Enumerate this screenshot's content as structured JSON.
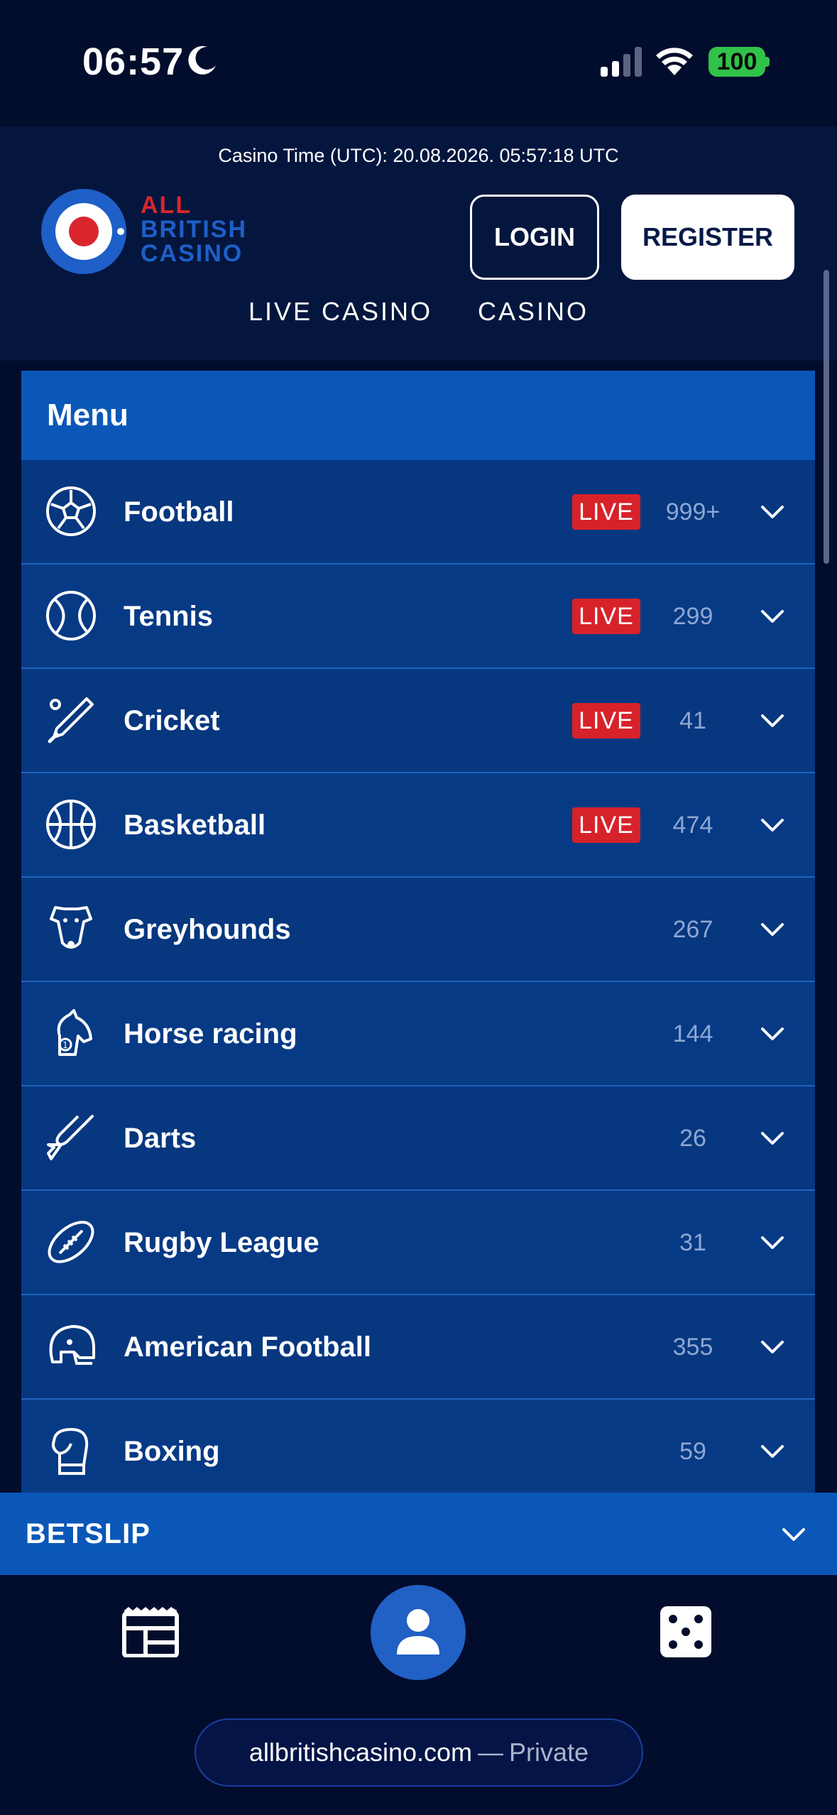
{
  "status_bar": {
    "time": "06:57",
    "battery": "100"
  },
  "header": {
    "casino_time": "Casino Time (UTC): 20.08.2026. 05:57:18 UTC",
    "logo": {
      "line1": "ALL",
      "line2": "BRITISH",
      "line3": "CASINO"
    },
    "login_label": "LOGIN",
    "register_label": "REGISTER",
    "nav": [
      "LIVE CASINO",
      "CASINO"
    ]
  },
  "menu": {
    "title": "Menu",
    "items": [
      {
        "label": "Football",
        "live": "LIVE",
        "count": "999+",
        "icon": "football-icon"
      },
      {
        "label": "Tennis",
        "live": "LIVE",
        "count": "299",
        "icon": "tennis-ball-icon"
      },
      {
        "label": "Cricket",
        "live": "LIVE",
        "count": "41",
        "icon": "cricket-bat-icon"
      },
      {
        "label": "Basketball",
        "live": "LIVE",
        "count": "474",
        "icon": "basketball-icon"
      },
      {
        "label": "Greyhounds",
        "live": "",
        "count": "267",
        "icon": "greyhound-icon"
      },
      {
        "label": "Horse racing",
        "live": "",
        "count": "144",
        "icon": "horse-head-icon"
      },
      {
        "label": "Darts",
        "live": "",
        "count": "26",
        "icon": "dart-icon"
      },
      {
        "label": "Rugby League",
        "live": "",
        "count": "31",
        "icon": "rugby-ball-icon"
      },
      {
        "label": "American Football",
        "live": "",
        "count": "355",
        "icon": "helmet-icon"
      },
      {
        "label": "Boxing",
        "live": "",
        "count": "59",
        "icon": "boxing-glove-icon"
      }
    ]
  },
  "betslip": {
    "label": "BETSLIP"
  },
  "browser": {
    "host": "allbritishcasino.com",
    "separator": "—",
    "mode": "Private"
  },
  "colors": {
    "background": "#020c2c",
    "header": "#04163d",
    "menu_header": "#0a57b8",
    "menu_row": "#06377f",
    "live_badge": "#d7222a",
    "accent_red": "#d9262e",
    "accent_blue": "#1e5fc8"
  }
}
